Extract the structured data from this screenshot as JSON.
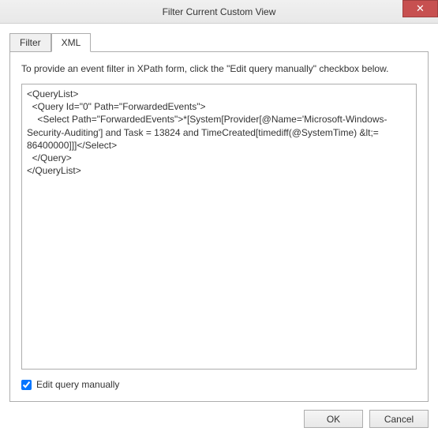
{
  "window": {
    "title": "Filter Current Custom View",
    "close_glyph": "✕"
  },
  "tabs": {
    "filter_label": "Filter",
    "xml_label": "XML"
  },
  "panel": {
    "instruction": "To provide an event filter in XPath form, click the \"Edit query manually\" checkbox below.",
    "xml_content": "<QueryList>\n  <Query Id=\"0\" Path=\"ForwardedEvents\">\n    <Select Path=\"ForwardedEvents\">*[System[Provider[@Name='Microsoft-Windows-Security-Auditing'] and Task = 13824 and TimeCreated[timediff(@SystemTime) &lt;= 86400000]]]</Select>\n  </Query>\n</QueryList>",
    "checkbox_label": "Edit query manually",
    "checkbox_checked": true
  },
  "buttons": {
    "ok_label": "OK",
    "cancel_label": "Cancel"
  }
}
